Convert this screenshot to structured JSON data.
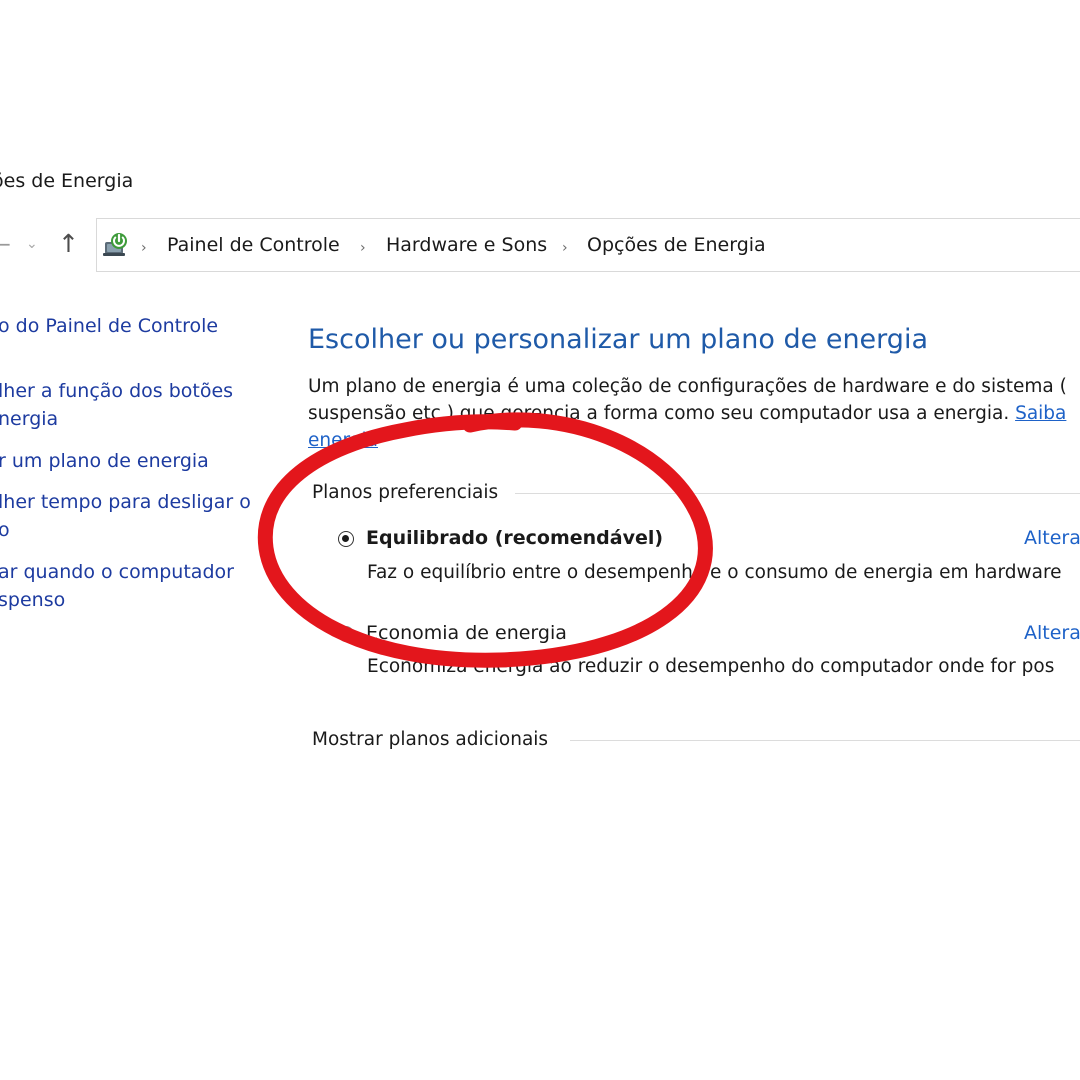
{
  "window": {
    "title": "ões de Energia"
  },
  "nav": {
    "back_icon": "back-arrow-icon",
    "history_icon": "chevron-down-icon",
    "up_icon": "up-arrow-icon"
  },
  "breadcrumb": {
    "icon": "power-options-icon",
    "items": [
      "Painel de Controle",
      "Hardware e Sons",
      "Opções de Energia"
    ]
  },
  "sidebar": {
    "items": [
      {
        "lines": [
          "o do Painel de Controle"
        ]
      },
      {
        "lines": [
          "lher a função dos botões",
          "nergia"
        ]
      },
      {
        "lines": [
          "r um plano de energia"
        ]
      },
      {
        "lines": [
          "lher tempo para desligar o",
          "o"
        ]
      },
      {
        "lines": [
          "ar quando o computador",
          "spenso"
        ]
      }
    ]
  },
  "main": {
    "heading": "Escolher ou personalizar um plano de energia",
    "description": {
      "line1": "Um plano de energia é uma coleção de configurações de hardware e do sistema (",
      "line2": "suspensão etc.) que gerencia a forma como seu computador usa a energia. ",
      "link_inline": "Saiba",
      "link_line3": "energia"
    },
    "preferred_group": {
      "label": "Planos preferenciais",
      "plans": [
        {
          "name": "Equilibrado (recomendável)",
          "description": "Faz o equilíbrio entre o desempenho e o consumo de energia em hardware",
          "change_label": "Altera",
          "selected": true
        },
        {
          "name": "Economia de energia",
          "description": "Economiza energia ao reduzir o desempenho do computador onde for pos",
          "change_label": "Altera",
          "selected": false
        }
      ]
    },
    "additional_group": {
      "label": "Mostrar planos adicionais"
    }
  },
  "colors": {
    "heading": "#1f5aa8",
    "link": "#1e62c8",
    "sidebar_link": "#1d3ba0",
    "annotation_circle": "#e3161c"
  }
}
